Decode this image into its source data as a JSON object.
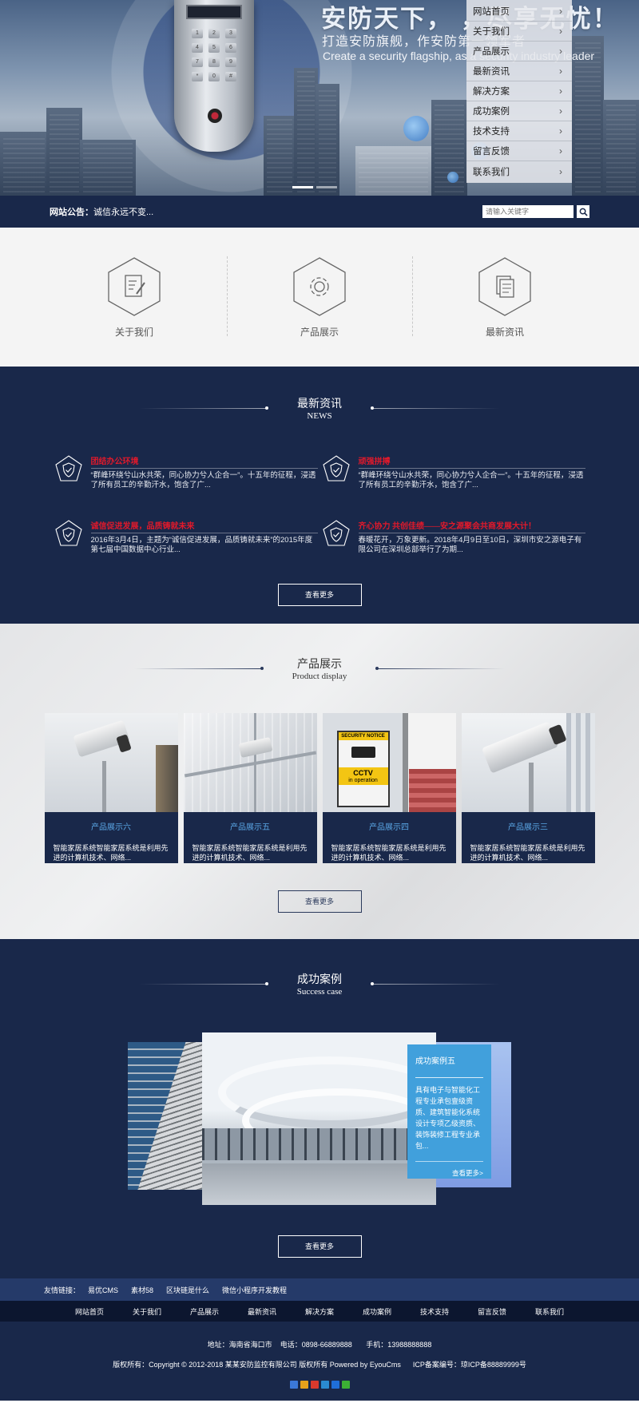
{
  "hero": {
    "title": "安防天下，  ，尽享无忧！",
    "subtitle": "打造安防旗舰，作安防第一领军者",
    "subtitle_en": "Create a security flagship, as a security industry leader",
    "slides": 2,
    "active_slide": 0,
    "device_keys": [
      "1",
      "2",
      "3",
      "4",
      "5",
      "6",
      "7",
      "8",
      "9",
      "*",
      "0",
      "#"
    ]
  },
  "sidenav": {
    "items": [
      {
        "label": "网站首页"
      },
      {
        "label": "关于我们"
      },
      {
        "label": "产品展示"
      },
      {
        "label": "最新资讯"
      },
      {
        "label": "解决方案"
      },
      {
        "label": "成功案例"
      },
      {
        "label": "技术支持"
      },
      {
        "label": "留言反馈"
      },
      {
        "label": "联系我们"
      }
    ]
  },
  "notice": {
    "label": "网站公告：",
    "text": "诚信永远不变...",
    "search_placeholder": "请输入关键字"
  },
  "features": [
    {
      "label": "关于我们",
      "icon": "edit-doc-icon"
    },
    {
      "label": "产品展示",
      "icon": "gear-icon"
    },
    {
      "label": "最新资讯",
      "icon": "documents-icon"
    }
  ],
  "news": {
    "title_cn": "最新资讯",
    "title_en": "NEWS",
    "items": [
      {
        "title": "团结办公环境",
        "desc": "“群峰环绕兮山水共荣，同心协力兮人企合一”。十五年的征程，浸透了所有员工的辛勤汗水，饱含了广..."
      },
      {
        "title": "顽强拼搏",
        "desc": "“群峰环绕兮山水共荣，同心协力兮人企合一”。十五年的征程，浸透了所有员工的辛勤汗水，饱含了广..."
      },
      {
        "title": "诚信促进发展，品质铸就未来",
        "desc": "2016年3月4日，主题为“诚信促进发展，品质铸就未来”的2015年度第七届中国数据中心行业..."
      },
      {
        "title": "齐心协力 共创佳绩——安之源聚会共商发展大计！",
        "desc": "春暖花开，万象更新。2018年4月9日至10日，深圳市安之源电子有限公司在深圳总部举行了为期..."
      }
    ],
    "more": "查看更多"
  },
  "products": {
    "title_cn": "产品展示",
    "title_en": "Product display",
    "items": [
      {
        "name": "产品展示六",
        "desc": "智能家居系统智能家居系统是利用先进的计算机技术、网络..."
      },
      {
        "name": "产品展示五",
        "desc": "智能家居系统智能家居系统是利用先进的计算机技术、网络..."
      },
      {
        "name": "产品展示四",
        "desc": "智能家居系统智能家居系统是利用先进的计算机技术、网络...",
        "sign_top": "SECURITY NOTICE",
        "sign_main": "CCTV",
        "sign_sub": "in operation"
      },
      {
        "name": "产品展示三",
        "desc": "智能家居系统智能家居系统是利用先进的计算机技术、网络..."
      }
    ],
    "more": "查看更多"
  },
  "cases": {
    "title_cn": "成功案例",
    "title_en": "Success case",
    "caption_title": "成功案例五",
    "caption_desc": "具有电子与智能化工程专业承包壹级资质、建筑智能化系统设计专项乙级资质、装饰装修工程专业承包...",
    "caption_more": "查看更多>",
    "more": "查看更多"
  },
  "links": {
    "label": "友情链接：",
    "items": [
      "易优CMS",
      "素材58",
      "区块链是什么",
      "微信小程序开发教程"
    ]
  },
  "footer_nav": [
    "网站首页",
    "关于我们",
    "产品展示",
    "最新资讯",
    "解决方案",
    "成功案例",
    "技术支持",
    "留言反馈",
    "联系我们"
  ],
  "footer": {
    "address": "地址：海南省海口市",
    "phone": "电话：0898-66889888",
    "mobile": "手机：13988888888",
    "copyright": "版权所有：Copyright © 2012-2018 某某安防监控有限公司 版权所有 Powered by EyouCms",
    "icp": "ICP备案编号：琼ICP备88889999号",
    "social": [
      {
        "icon": "share-plus-icon",
        "color": "#3b78d8"
      },
      {
        "icon": "qzone-icon",
        "color": "#e7a21b"
      },
      {
        "icon": "weibo-icon",
        "color": "#d8392d"
      },
      {
        "icon": "tencent-weibo-icon",
        "color": "#2a8ad1"
      },
      {
        "icon": "renren-icon",
        "color": "#1f6ed8"
      },
      {
        "icon": "wechat-icon",
        "color": "#3cb034"
      }
    ]
  }
}
